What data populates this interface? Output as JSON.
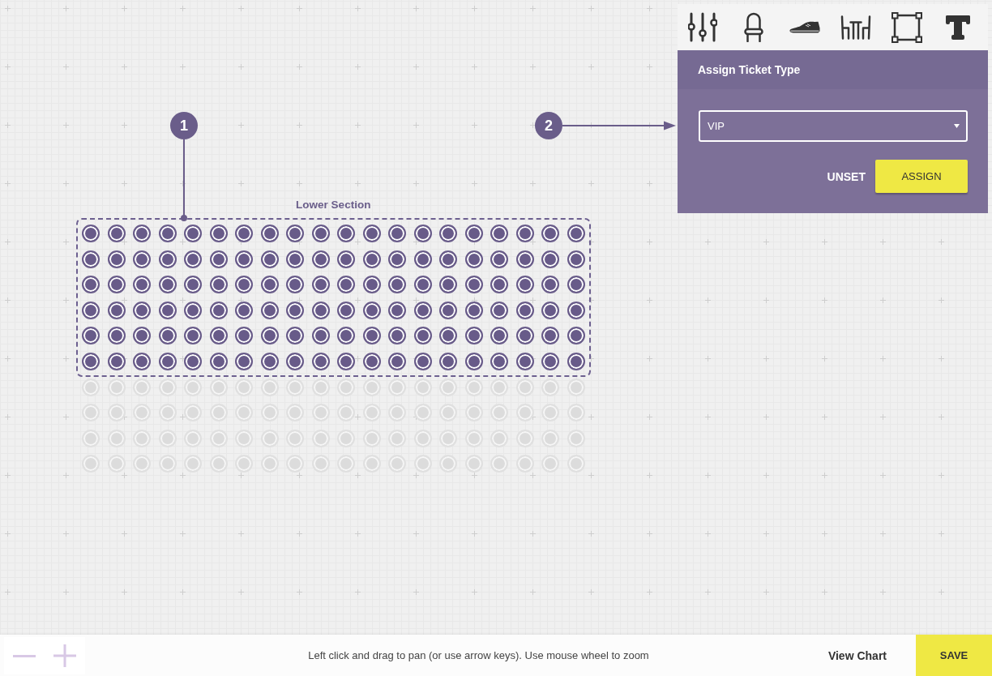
{
  "toolbar": {
    "tools": [
      {
        "kind": "sliders"
      },
      {
        "kind": "chair"
      },
      {
        "kind": "shoe"
      },
      {
        "kind": "table"
      },
      {
        "kind": "frame"
      },
      {
        "kind": "text"
      }
    ]
  },
  "assign_panel": {
    "title": "Assign Ticket Type",
    "ticket_type": {
      "value": "VIP"
    },
    "buttons": [
      {
        "label": "UNSET",
        "kind": "link"
      },
      {
        "label": "ASSIGN",
        "kind": "primary"
      }
    ]
  },
  "seat_map": {
    "section": {
      "label": "Lower Section",
      "rows": [
        {
          "seats": [
            {
              "selected": true
            },
            {
              "selected": true
            },
            {
              "selected": true
            },
            {
              "selected": true
            },
            {
              "selected": true
            },
            {
              "selected": true
            },
            {
              "selected": true
            },
            {
              "selected": true
            },
            {
              "selected": true
            },
            {
              "selected": true
            },
            {
              "selected": true
            },
            {
              "selected": true
            },
            {
              "selected": true
            },
            {
              "selected": true
            },
            {
              "selected": true
            },
            {
              "selected": true
            },
            {
              "selected": true
            },
            {
              "selected": true
            },
            {
              "selected": true
            },
            {
              "selected": true
            }
          ]
        },
        {
          "seats": [
            {
              "selected": true
            },
            {
              "selected": true
            },
            {
              "selected": true
            },
            {
              "selected": true
            },
            {
              "selected": true
            },
            {
              "selected": true
            },
            {
              "selected": true
            },
            {
              "selected": true
            },
            {
              "selected": true
            },
            {
              "selected": true
            },
            {
              "selected": true
            },
            {
              "selected": true
            },
            {
              "selected": true
            },
            {
              "selected": true
            },
            {
              "selected": true
            },
            {
              "selected": true
            },
            {
              "selected": true
            },
            {
              "selected": true
            },
            {
              "selected": true
            },
            {
              "selected": true
            }
          ]
        },
        {
          "seats": [
            {
              "selected": true
            },
            {
              "selected": true
            },
            {
              "selected": true
            },
            {
              "selected": true
            },
            {
              "selected": true
            },
            {
              "selected": true
            },
            {
              "selected": true
            },
            {
              "selected": true
            },
            {
              "selected": true
            },
            {
              "selected": true
            },
            {
              "selected": true
            },
            {
              "selected": true
            },
            {
              "selected": true
            },
            {
              "selected": true
            },
            {
              "selected": true
            },
            {
              "selected": true
            },
            {
              "selected": true
            },
            {
              "selected": true
            },
            {
              "selected": true
            },
            {
              "selected": true
            }
          ]
        },
        {
          "seats": [
            {
              "selected": true
            },
            {
              "selected": true
            },
            {
              "selected": true
            },
            {
              "selected": true
            },
            {
              "selected": true
            },
            {
              "selected": true
            },
            {
              "selected": true
            },
            {
              "selected": true
            },
            {
              "selected": true
            },
            {
              "selected": true
            },
            {
              "selected": true
            },
            {
              "selected": true
            },
            {
              "selected": true
            },
            {
              "selected": true
            },
            {
              "selected": true
            },
            {
              "selected": true
            },
            {
              "selected": true
            },
            {
              "selected": true
            },
            {
              "selected": true
            },
            {
              "selected": true
            }
          ]
        },
        {
          "seats": [
            {
              "selected": true
            },
            {
              "selected": true
            },
            {
              "selected": true
            },
            {
              "selected": true
            },
            {
              "selected": true
            },
            {
              "selected": true
            },
            {
              "selected": true
            },
            {
              "selected": true
            },
            {
              "selected": true
            },
            {
              "selected": true
            },
            {
              "selected": true
            },
            {
              "selected": true
            },
            {
              "selected": true
            },
            {
              "selected": true
            },
            {
              "selected": true
            },
            {
              "selected": true
            },
            {
              "selected": true
            },
            {
              "selected": true
            },
            {
              "selected": true
            },
            {
              "selected": true
            }
          ]
        },
        {
          "seats": [
            {
              "selected": true
            },
            {
              "selected": true
            },
            {
              "selected": true
            },
            {
              "selected": true
            },
            {
              "selected": true
            },
            {
              "selected": true
            },
            {
              "selected": true
            },
            {
              "selected": true
            },
            {
              "selected": true
            },
            {
              "selected": true
            },
            {
              "selected": true
            },
            {
              "selected": true
            },
            {
              "selected": true
            },
            {
              "selected": true
            },
            {
              "selected": true
            },
            {
              "selected": true
            },
            {
              "selected": true
            },
            {
              "selected": true
            },
            {
              "selected": true
            },
            {
              "selected": true
            }
          ]
        }
      ]
    },
    "rows": [
      {
        "seats": [
          {
            "selected": false
          },
          {
            "selected": false
          },
          {
            "selected": false
          },
          {
            "selected": false
          },
          {
            "selected": false
          },
          {
            "selected": false
          },
          {
            "selected": false
          },
          {
            "selected": false
          },
          {
            "selected": false
          },
          {
            "selected": false
          },
          {
            "selected": false
          },
          {
            "selected": false
          },
          {
            "selected": false
          },
          {
            "selected": false
          },
          {
            "selected": false
          },
          {
            "selected": false
          },
          {
            "selected": false
          },
          {
            "selected": false
          },
          {
            "selected": false
          },
          {
            "selected": false
          }
        ]
      },
      {
        "seats": [
          {
            "selected": false
          },
          {
            "selected": false
          },
          {
            "selected": false
          },
          {
            "selected": false
          },
          {
            "selected": false
          },
          {
            "selected": false
          },
          {
            "selected": false
          },
          {
            "selected": false
          },
          {
            "selected": false
          },
          {
            "selected": false
          },
          {
            "selected": false
          },
          {
            "selected": false
          },
          {
            "selected": false
          },
          {
            "selected": false
          },
          {
            "selected": false
          },
          {
            "selected": false
          },
          {
            "selected": false
          },
          {
            "selected": false
          },
          {
            "selected": false
          },
          {
            "selected": false
          }
        ]
      },
      {
        "seats": [
          {
            "selected": false
          },
          {
            "selected": false
          },
          {
            "selected": false
          },
          {
            "selected": false
          },
          {
            "selected": false
          },
          {
            "selected": false
          },
          {
            "selected": false
          },
          {
            "selected": false
          },
          {
            "selected": false
          },
          {
            "selected": false
          },
          {
            "selected": false
          },
          {
            "selected": false
          },
          {
            "selected": false
          },
          {
            "selected": false
          },
          {
            "selected": false
          },
          {
            "selected": false
          },
          {
            "selected": false
          },
          {
            "selected": false
          },
          {
            "selected": false
          },
          {
            "selected": false
          }
        ]
      },
      {
        "seats": [
          {
            "selected": false
          },
          {
            "selected": false
          },
          {
            "selected": false
          },
          {
            "selected": false
          },
          {
            "selected": false
          },
          {
            "selected": false
          },
          {
            "selected": false
          },
          {
            "selected": false
          },
          {
            "selected": false
          },
          {
            "selected": false
          },
          {
            "selected": false
          },
          {
            "selected": false
          },
          {
            "selected": false
          },
          {
            "selected": false
          },
          {
            "selected": false
          },
          {
            "selected": false
          },
          {
            "selected": false
          },
          {
            "selected": false
          },
          {
            "selected": false
          },
          {
            "selected": false
          }
        ]
      }
    ]
  },
  "callouts": [
    {
      "number": "1",
      "kind": "line"
    },
    {
      "number": "2",
      "kind": "arrow"
    }
  ],
  "bottom_bar": {
    "hint": "Left click and drag to pan (or use arrow keys). Use mouse wheel to zoom",
    "buttons": [
      {
        "label": "View Chart",
        "kind": "link"
      },
      {
        "label": "SAVE",
        "kind": "primary"
      }
    ]
  }
}
